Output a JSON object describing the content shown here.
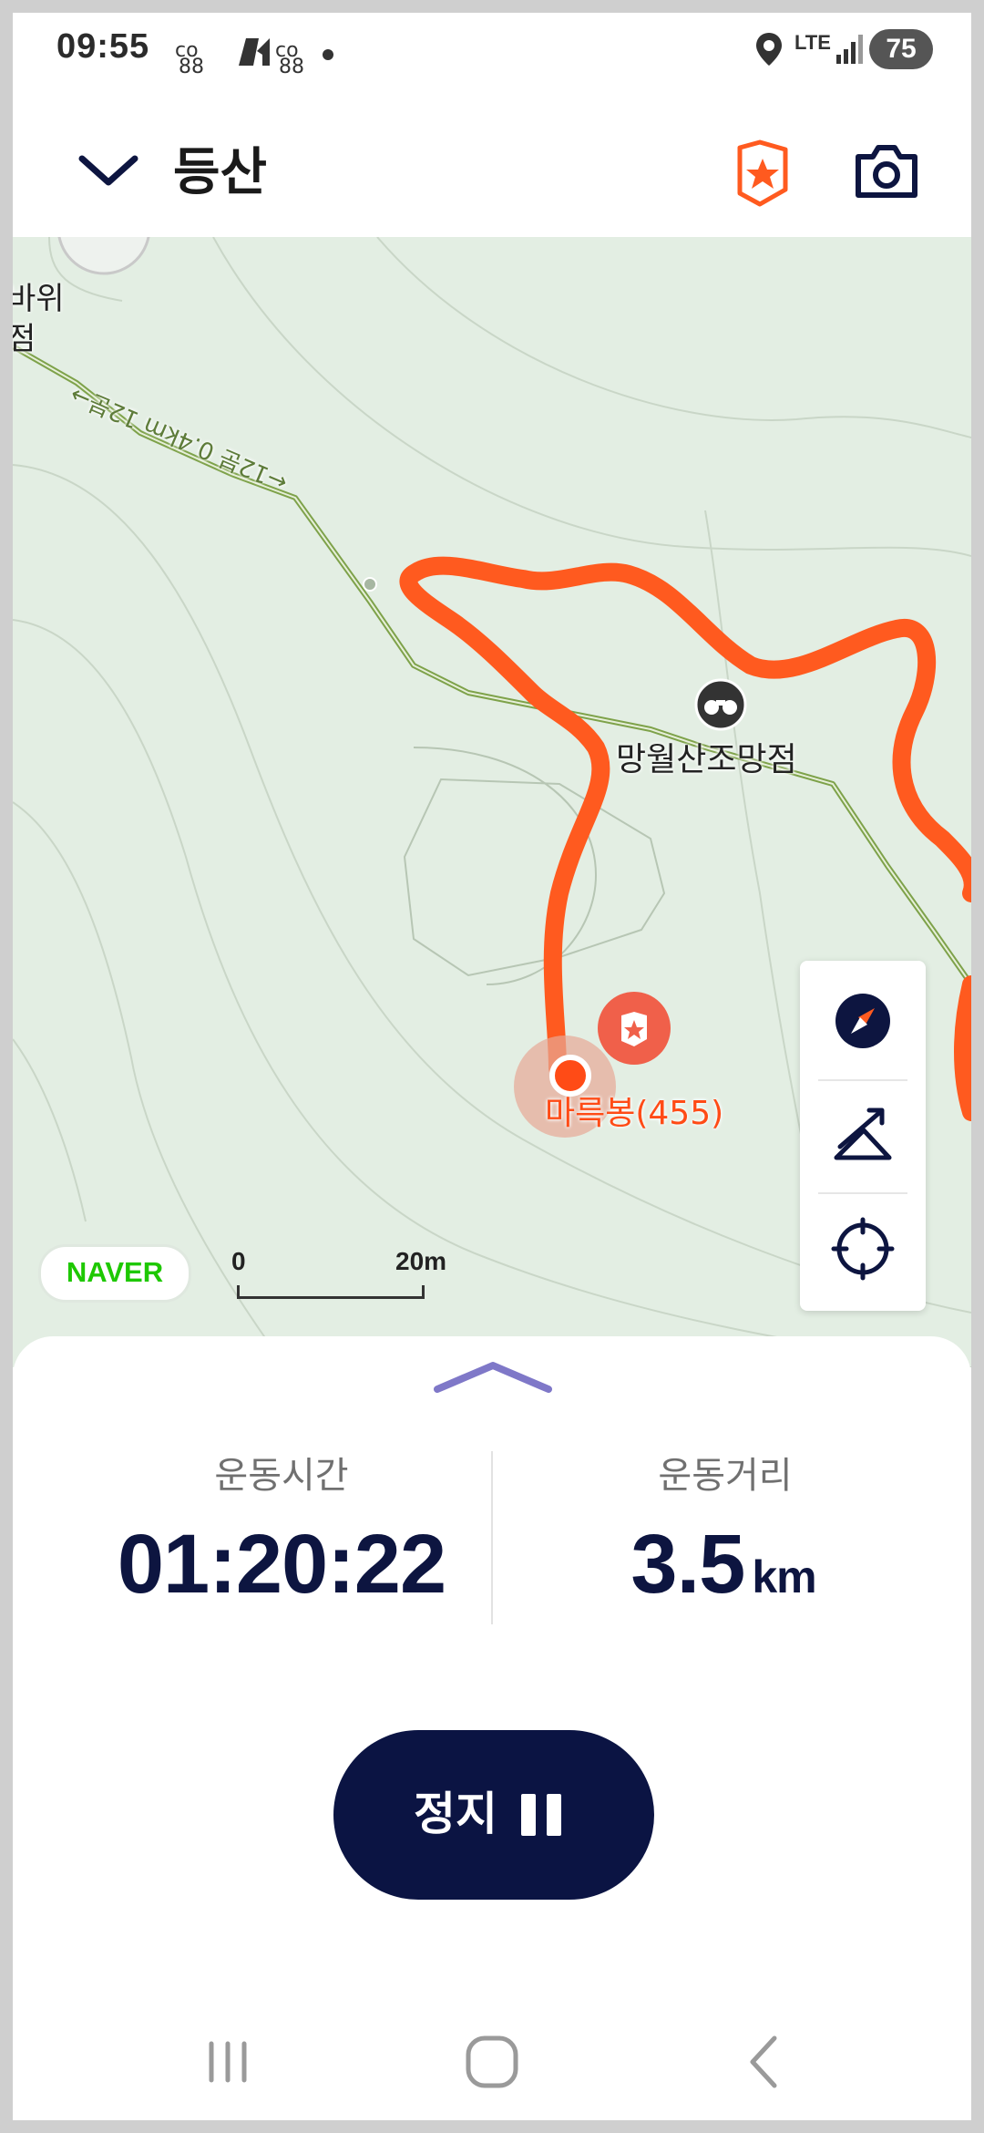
{
  "status_bar": {
    "time": "09:55",
    "network": "LTE",
    "battery": "75"
  },
  "header": {
    "title": "등산"
  },
  "map": {
    "trail_label": "←12분 0.4km 12분→",
    "place_top_left_line1": "바위",
    "place_top_left_line2": "점",
    "viewpoint_label": "망월산조망점",
    "peak_label": "마륵봉(455)",
    "provider_logo": "NAVER",
    "scale_start": "0",
    "scale_end": "20m",
    "colors": {
      "track": "#ff5a1f",
      "trail": "#7ea24a",
      "map_bg": "#e3eee3"
    }
  },
  "stats": {
    "time_label": "운동시간",
    "time_value": "01:20:22",
    "distance_label": "운동거리",
    "distance_value": "3.5",
    "distance_unit": "km"
  },
  "controls": {
    "stop_label": "정지"
  },
  "colors": {
    "accent": "#ff5a1f",
    "primary": "#0b1443",
    "handle": "#7f78c8"
  }
}
